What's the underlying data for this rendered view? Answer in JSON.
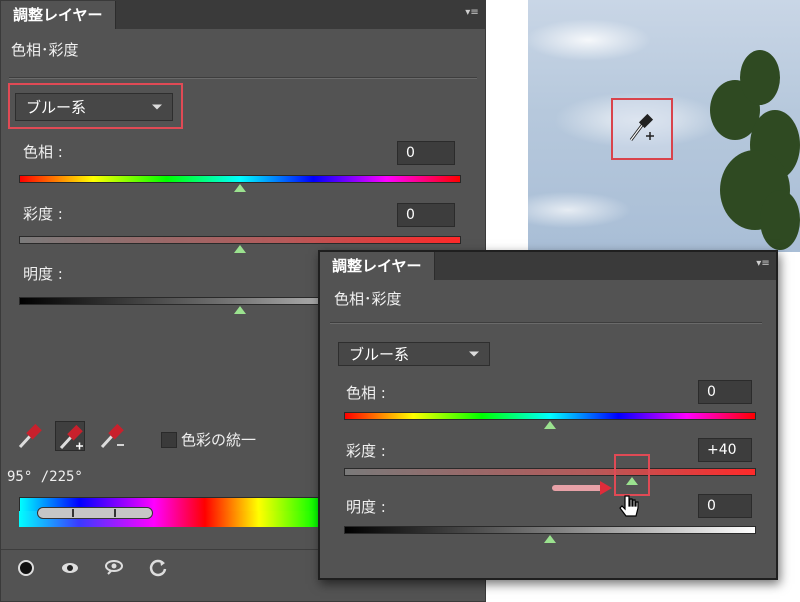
{
  "main_panel": {
    "tab_label": "調整レイヤー",
    "subtitle": "色相･彩度",
    "dropdown_value": "ブルー系",
    "hue": {
      "label": "色相 :",
      "value": "0"
    },
    "saturation": {
      "label": "彩度 :",
      "value": "0"
    },
    "lightness": {
      "label": "明度 :"
    },
    "colorize_label": "色彩の統一",
    "range_text": "95° /225°"
  },
  "small_panel": {
    "tab_label": "調整レイヤー",
    "subtitle": "色相･彩度",
    "dropdown_value": "ブルー系",
    "hue": {
      "label": "色相 :",
      "value": "0"
    },
    "saturation": {
      "label": "彩度 :",
      "value": "+40"
    },
    "lightness": {
      "label": "明度 :",
      "value": "0"
    }
  },
  "slider_levels": {
    "main_hue": 0.5,
    "main_saturation": 0.5,
    "main_lightness": 0.5,
    "small_hue": 0.5,
    "small_saturation": 0.7,
    "small_lightness": 0.5
  },
  "colors": {
    "panel_bg": "#535353",
    "highlight": "#e04a55",
    "knob": "#9be28f"
  },
  "icons": [
    "eyedropper-icon",
    "eyedropper-plus-icon",
    "eyedropper-minus-icon",
    "mask-icon",
    "eye-icon",
    "visibility-icon",
    "reset-icon",
    "cursor-hand-icon"
  ]
}
